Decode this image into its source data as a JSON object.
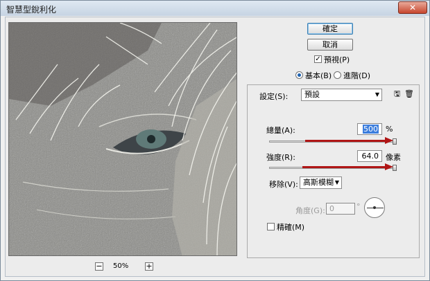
{
  "window": {
    "title": "智慧型銳利化",
    "close": "✕"
  },
  "preview": {
    "zoom": "50%",
    "zoom_out": "−",
    "zoom_in": "+"
  },
  "buttons": {
    "ok": "確定",
    "cancel": "取消"
  },
  "options": {
    "preview_label": "預視(P)",
    "preview_checked": true,
    "mode_basic": "基本(B)",
    "mode_advanced": "進階(D)",
    "selected_mode": "basic"
  },
  "settings": {
    "label": "設定(S):",
    "value": "預設"
  },
  "amount": {
    "label": "總量(A):",
    "value": "500",
    "unit": "%",
    "level": 1.0
  },
  "radius": {
    "label": "強度(R):",
    "value": "64.0",
    "unit": "像素",
    "level": 1.0
  },
  "remove": {
    "label": "移除(V):",
    "value": "高斯模糊"
  },
  "angle": {
    "label": "角度(G):",
    "value": "0",
    "unit": "°"
  },
  "more_accurate": {
    "label": "精確(M)",
    "checked": false
  },
  "colors": {
    "arrow": "#b01616",
    "highlight": "#3b7ddd"
  }
}
